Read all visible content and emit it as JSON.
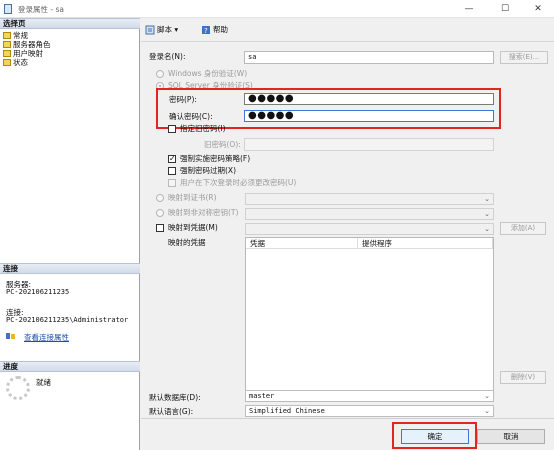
{
  "window": {
    "title": "登录属性 - sa",
    "minimize": "—",
    "maximize": "☐",
    "close": "✕"
  },
  "sidebar": {
    "select_page_header": "选择页",
    "items": [
      {
        "label": "常规"
      },
      {
        "label": "服务器角色"
      },
      {
        "label": "用户映射"
      },
      {
        "label": "状态"
      }
    ],
    "connection_header": "连接",
    "server_label": "服务器:",
    "server_value": "PC-202106211235",
    "connection_label": "连接:",
    "connection_value": "PC-202106211235\\Administrator",
    "view_connection_link": "查看连接属性",
    "progress_header": "进度",
    "progress_status": "就绪"
  },
  "toolbar": {
    "script_label": "脚本",
    "help_label": "帮助"
  },
  "form": {
    "login_name_label": "登录名(N):",
    "login_name_value": "sa",
    "search_button": "搜索(E)...",
    "windows_auth_label": "Windows 身份验证(W)",
    "sql_auth_label": "SQL Server 身份验证(S)",
    "password_label": "密码(P):",
    "password_value": "●●●●●",
    "confirm_password_label": "确认密码(C):",
    "confirm_password_value": "●●●●●",
    "specify_old_password_label": "指定旧密码(I)",
    "old_password_label": "旧密码(O):",
    "enforce_policy_label": "强制实施密码策略(F)",
    "enforce_expiration_label": "强制密码过期(X)",
    "must_change_label": "用户在下次登录时必须更改密码(U)",
    "map_cert_label": "映射到证书(R)",
    "map_asym_key_label": "映射到非对称密钥(T)",
    "map_credential_label": "映射到凭据(M)",
    "add_button": "添加(A)",
    "mapped_credentials_label": "映射的凭据",
    "grid_columns": [
      "凭据",
      "提供程序"
    ],
    "remove_button": "删除(V)",
    "default_db_label": "默认数据库(D):",
    "default_db_value": "master",
    "default_lang_label": "默认语言(G):",
    "default_lang_value": "Simplified Chinese"
  },
  "footer": {
    "ok_button": "确定",
    "cancel_button": "取消"
  },
  "colors": {
    "highlight_red": "#e0271f",
    "link_blue": "#1a4fb0"
  }
}
